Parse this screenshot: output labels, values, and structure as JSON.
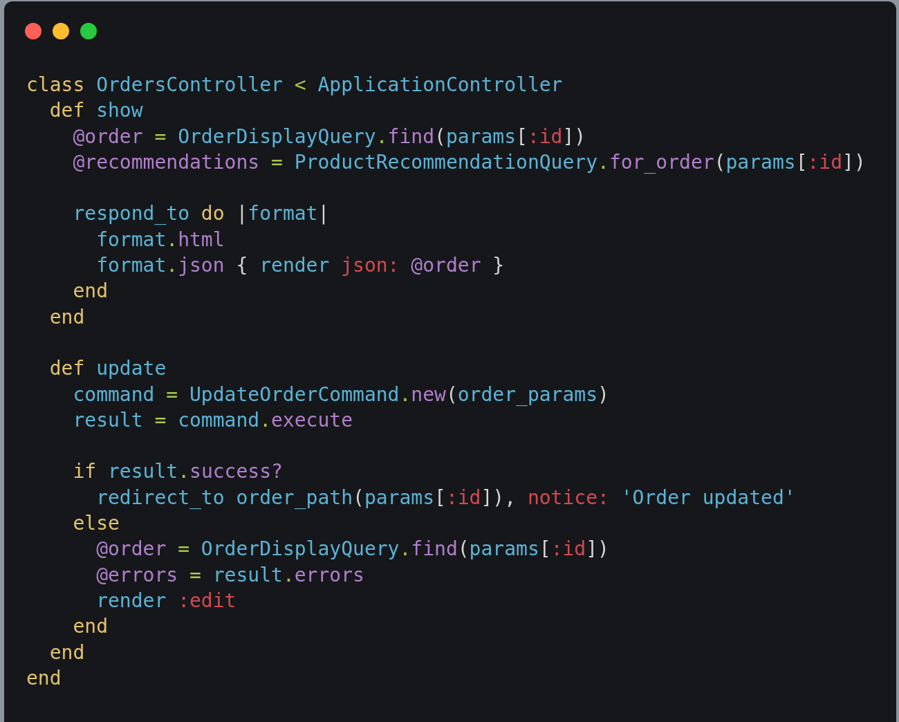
{
  "code_lines": [
    {
      "kind": "code",
      "tokens": [
        {
          "text": "class",
          "kind": "keyword"
        },
        {
          "text": " OrdersController",
          "kind": "name"
        },
        {
          "text": " <",
          "kind": "op"
        },
        {
          "text": " ApplicationController",
          "kind": "name"
        }
      ]
    },
    {
      "kind": "code",
      "tokens": [
        {
          "text": "  def",
          "kind": "keyword"
        },
        {
          "text": " show",
          "kind": "name"
        }
      ]
    },
    {
      "kind": "code",
      "tokens": [
        {
          "text": "    @order",
          "kind": "ivar"
        },
        {
          "text": " =",
          "kind": "op"
        },
        {
          "text": " OrderDisplayQuery",
          "kind": "name"
        },
        {
          "text": ".find",
          "kind": "call"
        },
        {
          "text": "(",
          "kind": "punct"
        },
        {
          "text": "params",
          "kind": "name"
        },
        {
          "text": "[",
          "kind": "punct"
        },
        {
          "text": ":id",
          "kind": "symbol"
        },
        {
          "text": "])",
          "kind": "punct"
        }
      ]
    },
    {
      "kind": "code",
      "tokens": [
        {
          "text": "    @recommendations",
          "kind": "ivar"
        },
        {
          "text": " =",
          "kind": "op"
        },
        {
          "text": " ProductRecommendationQuery",
          "kind": "name"
        },
        {
          "text": ".for_order",
          "kind": "call"
        },
        {
          "text": "(",
          "kind": "punct"
        },
        {
          "text": "params",
          "kind": "name"
        },
        {
          "text": "[",
          "kind": "punct"
        },
        {
          "text": ":id",
          "kind": "symbol"
        },
        {
          "text": "])",
          "kind": "punct"
        }
      ]
    },
    {
      "kind": "blank"
    },
    {
      "kind": "code",
      "tokens": [
        {
          "text": "    respond_to",
          "kind": "name"
        },
        {
          "text": " do",
          "kind": "keyword"
        },
        {
          "text": " |",
          "kind": "punct"
        },
        {
          "text": "format",
          "kind": "name"
        },
        {
          "text": "|",
          "kind": "punct"
        }
      ]
    },
    {
      "kind": "code",
      "tokens": [
        {
          "text": "      format",
          "kind": "name"
        },
        {
          "text": ".html",
          "kind": "call"
        }
      ]
    },
    {
      "kind": "code",
      "tokens": [
        {
          "text": "      format",
          "kind": "name"
        },
        {
          "text": ".json",
          "kind": "call"
        },
        {
          "text": " {",
          "kind": "punct"
        },
        {
          "text": " render",
          "kind": "name"
        },
        {
          "text": " json:",
          "kind": "symbol"
        },
        {
          "text": " @order",
          "kind": "ivar"
        },
        {
          "text": " }",
          "kind": "punct"
        }
      ]
    },
    {
      "kind": "code",
      "tokens": [
        {
          "text": "    end",
          "kind": "keyword"
        }
      ]
    },
    {
      "kind": "code",
      "tokens": [
        {
          "text": "  end",
          "kind": "keyword"
        }
      ]
    },
    {
      "kind": "blank"
    },
    {
      "kind": "code",
      "tokens": [
        {
          "text": "  def",
          "kind": "keyword"
        },
        {
          "text": " update",
          "kind": "name"
        }
      ]
    },
    {
      "kind": "code",
      "tokens": [
        {
          "text": "    command",
          "kind": "name"
        },
        {
          "text": " =",
          "kind": "op"
        },
        {
          "text": " UpdateOrderCommand",
          "kind": "name"
        },
        {
          "text": ".new",
          "kind": "call"
        },
        {
          "text": "(",
          "kind": "punct"
        },
        {
          "text": "order_params",
          "kind": "name"
        },
        {
          "text": ")",
          "kind": "punct"
        }
      ]
    },
    {
      "kind": "code",
      "tokens": [
        {
          "text": "    result",
          "kind": "name"
        },
        {
          "text": " =",
          "kind": "op"
        },
        {
          "text": " command",
          "kind": "name"
        },
        {
          "text": ".execute",
          "kind": "call"
        }
      ]
    },
    {
      "kind": "blank"
    },
    {
      "kind": "code",
      "tokens": [
        {
          "text": "    if",
          "kind": "keyword"
        },
        {
          "text": " result",
          "kind": "name"
        },
        {
          "text": ".success?",
          "kind": "call"
        }
      ]
    },
    {
      "kind": "code",
      "tokens": [
        {
          "text": "      redirect_to",
          "kind": "name"
        },
        {
          "text": " order_path",
          "kind": "name"
        },
        {
          "text": "(",
          "kind": "punct"
        },
        {
          "text": "params",
          "kind": "name"
        },
        {
          "text": "[",
          "kind": "punct"
        },
        {
          "text": ":id",
          "kind": "symbol"
        },
        {
          "text": "]),",
          "kind": "punct"
        },
        {
          "text": " notice:",
          "kind": "symbol"
        },
        {
          "text": " 'Order updated'",
          "kind": "name"
        }
      ]
    },
    {
      "kind": "code",
      "tokens": [
        {
          "text": "    else",
          "kind": "keyword"
        }
      ]
    },
    {
      "kind": "code",
      "tokens": [
        {
          "text": "      @order",
          "kind": "ivar"
        },
        {
          "text": " =",
          "kind": "op"
        },
        {
          "text": " OrderDisplayQuery",
          "kind": "name"
        },
        {
          "text": ".find",
          "kind": "call"
        },
        {
          "text": "(",
          "kind": "punct"
        },
        {
          "text": "params",
          "kind": "name"
        },
        {
          "text": "[",
          "kind": "punct"
        },
        {
          "text": ":id",
          "kind": "symbol"
        },
        {
          "text": "])",
          "kind": "punct"
        }
      ]
    },
    {
      "kind": "code",
      "tokens": [
        {
          "text": "      @errors",
          "kind": "ivar"
        },
        {
          "text": " =",
          "kind": "op"
        },
        {
          "text": " result",
          "kind": "name"
        },
        {
          "text": ".errors",
          "kind": "call"
        }
      ]
    },
    {
      "kind": "code",
      "tokens": [
        {
          "text": "      render",
          "kind": "name"
        },
        {
          "text": " :edit",
          "kind": "symbol"
        }
      ]
    },
    {
      "kind": "code",
      "tokens": [
        {
          "text": "    end",
          "kind": "keyword"
        }
      ]
    },
    {
      "kind": "code",
      "tokens": [
        {
          "text": "  end",
          "kind": "keyword"
        }
      ]
    },
    {
      "kind": "code",
      "tokens": [
        {
          "text": "end",
          "kind": "keyword"
        }
      ]
    }
  ]
}
